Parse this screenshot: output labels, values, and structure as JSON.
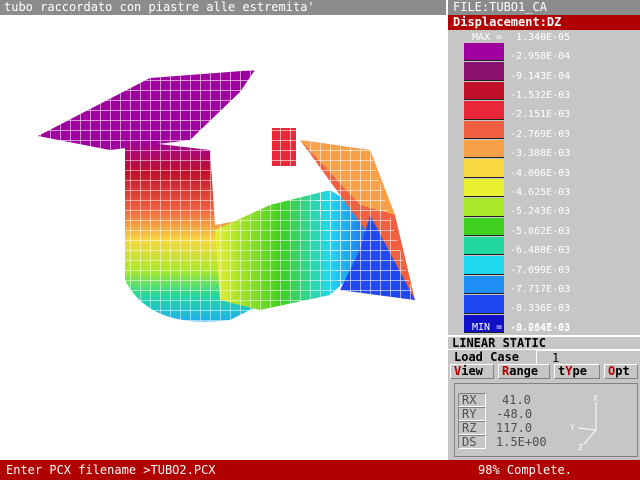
{
  "window": {
    "title": "tubo raccordato con piastre alle estremita'",
    "file_label": "FILE:TUBO1_CA"
  },
  "legend": {
    "title": "Displacement:DZ",
    "max_label": "MAX =",
    "max_value": "1.340E-05",
    "min_label": "MIN =",
    "min_value": "-9.264E-03",
    "levels": [
      {
        "value": "-2.958E-04",
        "color": "#a000a0"
      },
      {
        "value": "-9.143E-04",
        "color": "#8a1070"
      },
      {
        "value": "-1.532E-03",
        "color": "#c0102a"
      },
      {
        "value": "-2.151E-03",
        "color": "#e82838"
      },
      {
        "value": "-2.769E-03",
        "color": "#f06040"
      },
      {
        "value": "-3.388E-03",
        "color": "#f8a048"
      },
      {
        "value": "-4.006E-03",
        "color": "#f8d840"
      },
      {
        "value": "-4.625E-03",
        "color": "#e8f030"
      },
      {
        "value": "-5.243E-03",
        "color": "#a8e828"
      },
      {
        "value": "-5.862E-03",
        "color": "#40d020"
      },
      {
        "value": "-6.480E-03",
        "color": "#20d8a0"
      },
      {
        "value": "-7.099E-03",
        "color": "#20d8f0"
      },
      {
        "value": "-7.717E-03",
        "color": "#2090f8"
      },
      {
        "value": "-8.336E-03",
        "color": "#2048f0"
      },
      {
        "value": "-8.954E-03",
        "color": "#1010c8"
      }
    ]
  },
  "analysis": {
    "type": "LINEAR STATIC",
    "load_case_label": "Load Case",
    "load_case_value": "1"
  },
  "menu": [
    {
      "hot": "V",
      "rest": "iew"
    },
    {
      "hot": "R",
      "rest": "ange"
    },
    {
      "pre": "t",
      "hot": "Y",
      "rest": "pe"
    },
    {
      "hot": "O",
      "rest": "pt"
    }
  ],
  "rotation": {
    "rx_label": "RX",
    "rx_value": "41.0",
    "ry_label": "RY",
    "ry_value": "-48.0",
    "rz_label": "RZ",
    "rz_value": "117.0",
    "ds_label": "DS",
    "ds_value": "1.5E+00",
    "axes": {
      "x": "X",
      "y": "Y",
      "z": "Z"
    }
  },
  "status": {
    "prompt": "Enter PCX filename >TUBO2.PCX",
    "progress": "98% Complete."
  }
}
